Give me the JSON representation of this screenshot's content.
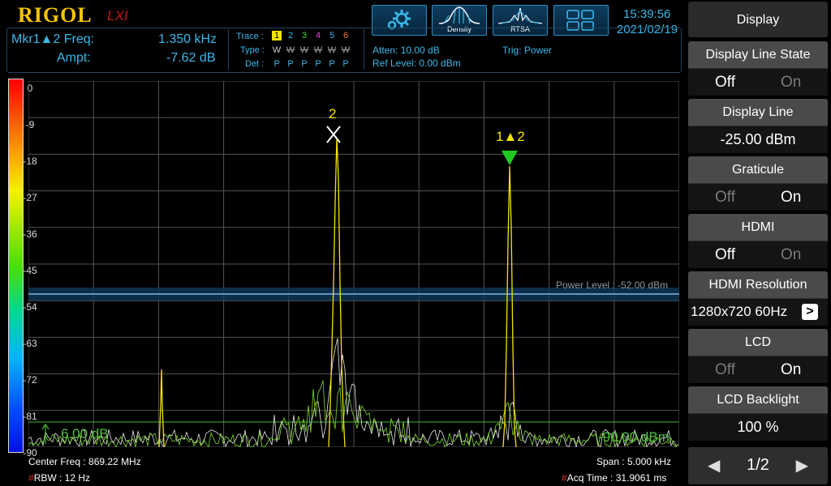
{
  "header": {
    "logo": "RIGOL",
    "logo_sub": "LXI",
    "time": "15:39:56",
    "date": "2021/02/19",
    "density_label": "Density",
    "rtsa_label": "RTSA"
  },
  "marker": {
    "freq_label": "Mkr1▲2 Freq:",
    "freq_value": "1.350 kHz",
    "ampt_label": "Ampt:",
    "ampt_value": "-7.62 dB"
  },
  "trace": {
    "trace_label": "Trace :",
    "type_label": "Type :",
    "det_label": "Det :",
    "numbers": [
      "1",
      "2",
      "3",
      "4",
      "5",
      "6"
    ],
    "types": [
      "W",
      "W",
      "W",
      "W",
      "W",
      "W"
    ],
    "dets": [
      "P",
      "P",
      "P",
      "P",
      "P",
      "P"
    ],
    "colors": [
      "#f5e400",
      "#3ab8ea",
      "#3bdc3b",
      "#e040e0",
      "#3ab8ea",
      "#f07830"
    ]
  },
  "status": {
    "atten": "Atten: 10.00 dB",
    "ref_level": "Ref Level: 0.00 dBm",
    "trig": "Trig: Power"
  },
  "plot": {
    "yticks": [
      "0",
      "-9",
      "-18",
      "-27",
      "-36",
      "-45",
      "-54",
      "-63",
      "-72",
      "-81",
      "-90"
    ],
    "power_level": "Power Level : -52.00 dBm",
    "left_db": "6.00 dB",
    "bottom_dbm": "-90.00 dBm",
    "marker2": "2",
    "marker1": "1▲2"
  },
  "footer": {
    "center": "Center Freq : 869.22 MHz",
    "rbw_hash": "#",
    "rbw": "RBW : 12 Hz",
    "span": "Span : 5.000 kHz",
    "acq_hash": "#",
    "acq": "Acq Time : 31.9061 ms"
  },
  "menu": {
    "title": "Display",
    "display_line_state": {
      "label": "Display Line State",
      "off": "Off",
      "on": "On"
    },
    "display_line": {
      "label": "Display Line",
      "value": "-25.00 dBm"
    },
    "graticule": {
      "label": "Graticule",
      "off": "Off",
      "on": "On"
    },
    "hdmi": {
      "label": "HDMI",
      "off": "Off",
      "on": "On"
    },
    "hdmi_resolution": {
      "label": "HDMI Resolution",
      "value": "1280x720 60Hz"
    },
    "lcd": {
      "label": "LCD",
      "off": "Off",
      "on": "On"
    },
    "lcd_backlight": {
      "label": "LCD Backlight",
      "value": "100 %"
    },
    "page": "1/2"
  }
}
